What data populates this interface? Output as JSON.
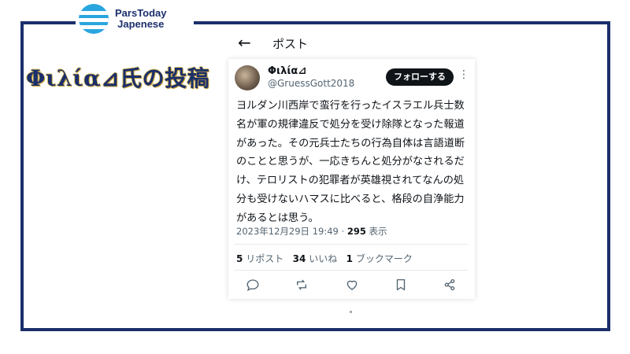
{
  "logo": {
    "line1": "ParsToday",
    "line2": "Japenese"
  },
  "headline": "Φιλία⊿氏の投稿",
  "header": {
    "back_icon": "←",
    "title": "ポスト"
  },
  "post": {
    "author_name": "Φιλία⊿",
    "author_handle": "@GruessGott2018",
    "follow_label": "フォローする",
    "more_icon": "⋮",
    "text": "ヨルダン川西岸で蛮行を行ったイスラエル兵士数名が軍の規律違反で処分を受け除隊となった報道があった。その元兵士たちの行為自体は言語道断のことと思うが、一応きちんと処分がなされるだけ、テロリストの犯罪者が英雄視されてなんの処分も受けないハマスに比べると、格段の自浄能力があるとは思う。",
    "timestamp": "2023年12月29日 19:49",
    "separator": "·",
    "views_count": "295",
    "views_label": "表示"
  },
  "stats": {
    "reposts_count": "5",
    "reposts_label": "リポスト",
    "likes_count": "34",
    "likes_label": "いいね",
    "bookmarks_count": "1",
    "bookmarks_label": "ブックマーク"
  },
  "actions": [
    "reply-icon",
    "repost-icon",
    "like-icon",
    "bookmark-icon",
    "share-icon"
  ],
  "colors": {
    "brand_navy": "#1b2f6b",
    "logo_blue": "#2aa6df",
    "text": "#0f1419",
    "muted": "#536471"
  }
}
